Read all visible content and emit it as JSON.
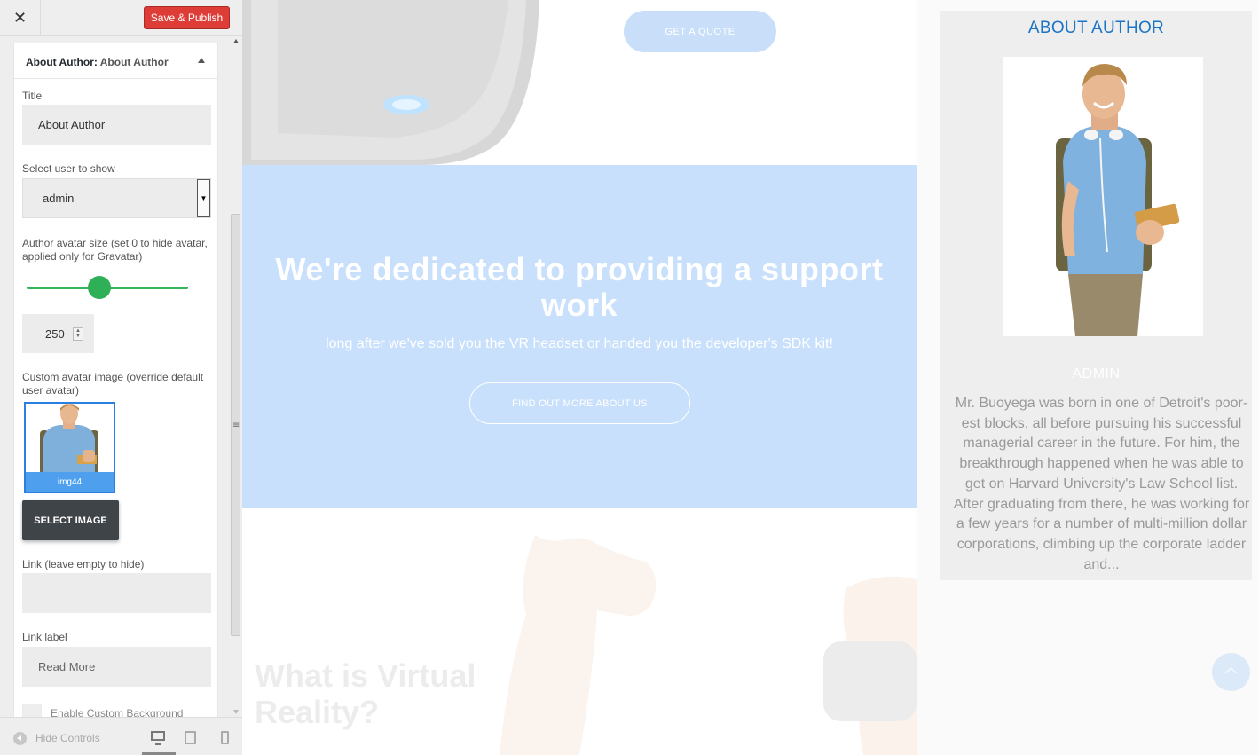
{
  "header": {
    "close_glyph": "✕",
    "publish_label": "Save & Publish"
  },
  "panel": {
    "section_prefix": "About Author:",
    "section_name": "About Author",
    "title_label": "Title",
    "title_value": "About Author",
    "user_label": "Select user to show",
    "user_value": "admin",
    "avatar_size_label": "Author avatar size (set 0 to hide avatar, applied only for Gravatar)",
    "avatar_size_value": "250",
    "custom_avatar_label": "Custom avatar image (override default user avatar)",
    "image_caption": "img44",
    "select_image_label": "SELECT IMAGE",
    "link_label": "Link (leave empty to hide)",
    "link_value": "",
    "link_label_label": "Link label",
    "link_label_value": "Read More",
    "custom_bg_label": "Enable Custom Background"
  },
  "footer": {
    "hide_controls_label": "Hide Controls"
  },
  "preview": {
    "quote_button": "GET A QUOTE",
    "band_title": "We're dedicated to providing a support work",
    "band_subtitle": "long after we've sold you the VR headset or handed you the developer's SDK kit!",
    "band_button": "FIND OUT MORE ABOUT US",
    "vr_title": "What is Virtual Reality?"
  },
  "widget": {
    "title": "ABOUT AUTHOR",
    "author_name": "ADMIN",
    "bio": "Mr. Buoyega was born in one of Detroit's poor-est blocks, all before pursuing his successful managerial career in the future. For him, the breakthrough happened when he was able to get on Harvard University's Law School list. After graduating from there, he was working for a few years for a number of multi-million dollar corporations, climbing up the corporate ladder and..."
  },
  "colors": {
    "publish": "#dd3d36",
    "slider": "#34b55a",
    "band": "#c8e0fb",
    "widget_title": "#1b74c5"
  },
  "slider_level": 0.45
}
